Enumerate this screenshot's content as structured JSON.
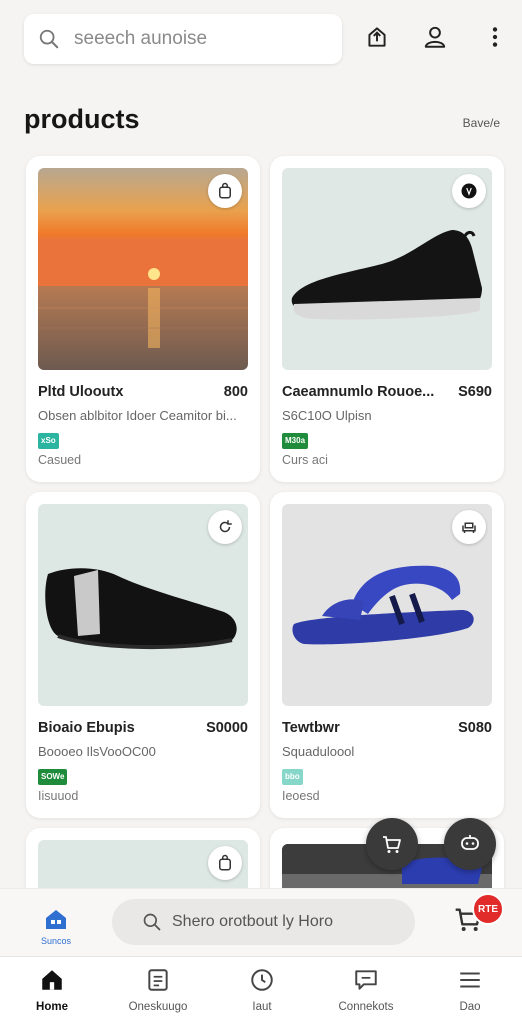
{
  "header": {
    "search_placeholder": "seeech aunoise",
    "icons": [
      "share-icon",
      "user-icon",
      "more-vertical-icon"
    ]
  },
  "section": {
    "title": "products",
    "link": "Bave/e"
  },
  "products": [
    {
      "name": "Pltd Ulooutx",
      "price": "800",
      "description": "Obsen ablbitor Idoer Ceamitor bi...",
      "badge": "xSo",
      "badge_color": "#2bb5a0",
      "status": "Casued",
      "image": "sunset-seascape",
      "fav_icon": "bag-icon"
    },
    {
      "name": "Caeamnumlo Rouoe...",
      "price": "S690",
      "description": "S6C10O Ulpisn",
      "badge": "M30a",
      "badge_color": "#1e8c3a",
      "status": "Curs aci",
      "image": "black-slip-on-sneaker",
      "fav_icon": "dark-circle-icon"
    },
    {
      "name": "Bioaio Ebupis",
      "price": "S0000",
      "description": "Boooeo IlsVooOC00",
      "badge": "SOWe",
      "badge_color": "#1e8c3a",
      "status": "Iisuuod",
      "image": "black-loafer",
      "fav_icon": "refresh-icon"
    },
    {
      "name": "Tewtbwr",
      "price": "S080",
      "description": "Squaduloool",
      "badge": "bbo",
      "badge_color": "#86d6c9",
      "status": "Ieoesd",
      "image": "blue-sandal",
      "fav_icon": "sofa-icon"
    }
  ],
  "floating": {
    "cart_button_icon": "cart-icon",
    "chat_button_icon": "chat-icon"
  },
  "bottom_strip": {
    "home_label": "Suncos",
    "search_text": "Shero orotbout ly Horo",
    "cart_count": "RTE"
  },
  "nav": [
    {
      "label": "Home",
      "icon": "home-icon",
      "active": true
    },
    {
      "label": "Oneskuugo",
      "icon": "list-icon",
      "active": false
    },
    {
      "label": "Iaut",
      "icon": "clock-icon",
      "active": false
    },
    {
      "label": "Connekots",
      "icon": "chat-icon",
      "active": false
    },
    {
      "label": "Dao",
      "icon": "menu-icon",
      "active": false
    }
  ],
  "colors": {
    "accent_blue": "#2f6fd0",
    "cart_badge": "#e12a2a",
    "background": "#f6f4f2"
  }
}
